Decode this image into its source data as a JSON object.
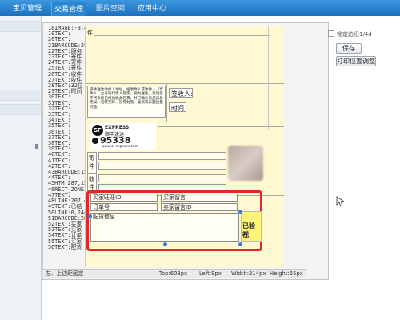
{
  "nav": {
    "tabs": [
      {
        "label": ""
      },
      {
        "label": "宝贝管理"
      },
      {
        "label": "交易管理"
      },
      {
        "label": "图片空间"
      },
      {
        "label": "应用中心"
      }
    ]
  },
  "editor": {
    "line_items": [
      "18IMAGE:-3,4",
      "19TEXT:",
      "20TEXT:",
      "21BARCODE:28",
      "22TEXT:服务",
      "23TEXT:寄件",
      "24TEXT:寄件",
      "25TEXT:寄件",
      "26TEXT:收件",
      "27TEXT:收件",
      "28TEXT:32位",
      "29TEXT:时间",
      "30TEXT:",
      "31TEXT:",
      "32TEXT:",
      "33TEXT:",
      "34TEXT:",
      "35TEXT:",
      "36TEXT:",
      "37TEXT:",
      "38TEXT:",
      "39TEXT:",
      "40TEXT:",
      "41TEXT:",
      "42TEXT:",
      "43BARCODE:15",
      "44TEXT:",
      "45HTM:287,15",
      "46RECT_ZONE:",
      "47TEXT:",
      "48LINE:207,4",
      "49TEXT:已结",
      "50LINE:0,244",
      "51BARCODE:28",
      "52TEXT:买家",
      "53TEXT:买家",
      "54TEXT:订单",
      "55TEXT:买家",
      "56TEXT:配货"
    ],
    "waybill": {
      "top_label": "件",
      "notice_text": "快件送达收件人地址，经收件人或收件人（寄件人）允许的代收人签字，视为送达。您的签字代表您已经验收此包裹，并已确认商品信息无误、包装完好、没有划痕、破损等表面质量问题。",
      "sign_label": "签收人:",
      "time_label": "时间",
      "sf_brand": "SF",
      "sf_express": "EXPRESS",
      "sf_cn": "顺丰速运",
      "sf_hotline": "95338",
      "sf_url": "www.sf-express.com",
      "send_label": "寄件",
      "recv_label": "收件"
    },
    "selection": {
      "buyer_id": "买家旺旺ID",
      "buyer_msg": "买家留言",
      "order_no": "订单号",
      "seller_msg_id": "卖家留言ID",
      "pick_info": "配货信息",
      "checked_stamp": "已验视"
    }
  },
  "right_panel": {
    "top_text": "锁定边沿1/4d",
    "save_button": "保存",
    "print_adjust_button": "打印位置调整"
  },
  "status": {
    "hint": "左、上边距固定",
    "top": "Top:608px",
    "left": "Left:9px",
    "width": "Width:314px",
    "height": "Height:65px"
  },
  "colors": {
    "nav_blue": "#1c70bd",
    "selection_red": "#e02828",
    "canvas_yellow": "#fff8d0",
    "handle_blue": "#3a7bd5"
  }
}
